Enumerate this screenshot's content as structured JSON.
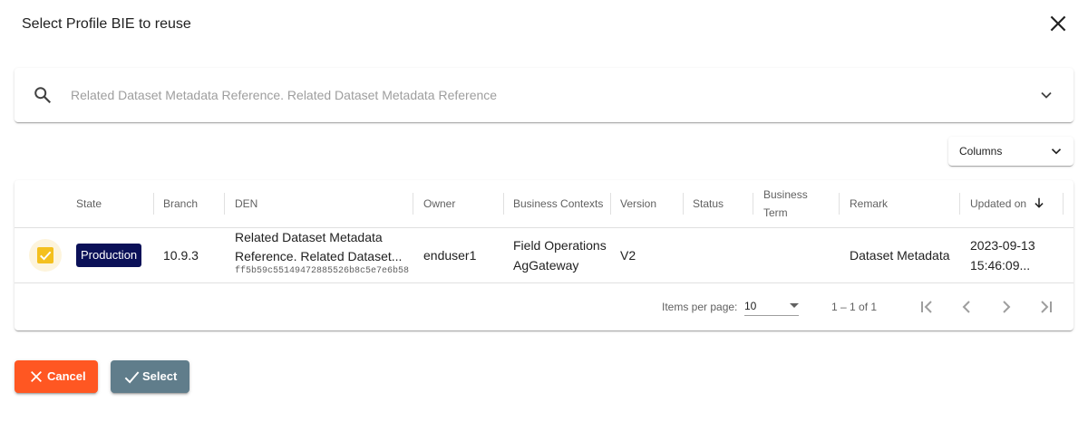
{
  "dialog": {
    "title": "Select Profile BIE to reuse"
  },
  "search": {
    "placeholder": "Related Dataset Metadata Reference. Related Dataset Metadata Reference",
    "value": ""
  },
  "columns_button": {
    "label": "Columns"
  },
  "table": {
    "headers": {
      "state": "State",
      "branch": "Branch",
      "den": "DEN",
      "owner": "Owner",
      "business_contexts": "Business Contexts",
      "version": "Version",
      "status": "Status",
      "business_term_line1": "Business",
      "business_term_line2": "Term",
      "remark": "Remark",
      "updated_on": "Updated on"
    },
    "sort": {
      "column": "Updated on",
      "direction": "descending"
    },
    "rows": [
      {
        "selected": true,
        "state": "Production",
        "branch": "10.9.3",
        "den_line1": "Related Dataset Metadata",
        "den_line2": "Reference. Related Dataset...",
        "den_id": "ff5b59c55149472885526b8c5e7e6b58",
        "owner": "enduser1",
        "business_context_1": "Field Operations",
        "business_context_2": "AgGateway",
        "version": "V2",
        "status": "",
        "business_term": "",
        "remark": "Dataset Metadata",
        "updated_date": "2023-09-13",
        "updated_time": "15:46:09..."
      }
    ]
  },
  "paginator": {
    "items_per_page_label": "Items per page:",
    "page_size": "10",
    "range_label": "1 – 1 of 1"
  },
  "actions": {
    "cancel_label": "Cancel",
    "select_label": "Select"
  },
  "colors": {
    "state_badge": "#0b1158",
    "checkbox": "#f4c01e",
    "cancel_button": "#ff5722",
    "select_button": "#607d8b"
  },
  "icons": {
    "close": "close-icon",
    "search": "search-icon",
    "expand": "chevron-down-icon",
    "sort": "arrow-down-icon",
    "check": "check-icon",
    "first_page": "first-page-icon",
    "previous_page": "chevron-left-icon",
    "next_page": "chevron-right-icon",
    "last_page": "last-page-icon"
  }
}
